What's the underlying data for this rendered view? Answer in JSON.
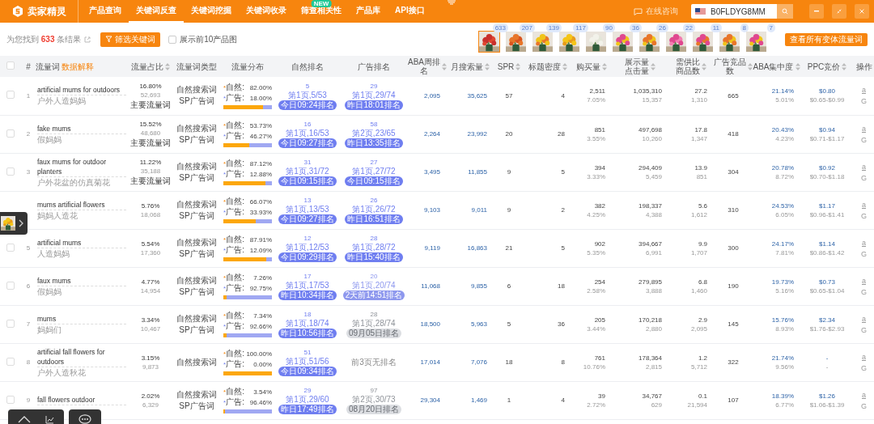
{
  "nav": {
    "brand": "卖家精灵",
    "items": [
      {
        "label": "产品查询",
        "selected": false
      },
      {
        "label": "关键词反查",
        "selected": true
      },
      {
        "label": "关键词挖掘",
        "selected": false
      },
      {
        "label": "关键词收录",
        "selected": false
      },
      {
        "label": "筛查相关性",
        "selected": false,
        "badge": "NEW"
      },
      {
        "label": "产品库",
        "selected": false
      },
      {
        "label": "API接口",
        "selected": false
      }
    ],
    "consult": "在线咨询",
    "search": {
      "value": "B0FLDYG8MM"
    }
  },
  "toolbar": {
    "summary": "为您找到 **633** 条结果",
    "filter_button": "筛选关键词",
    "show_images": {
      "label": "展示前10产品图",
      "checked": false
    },
    "variants_button": "查看所有变体流量词",
    "thumbnails": [
      {
        "count": "633",
        "selected": true
      },
      {
        "count": "207",
        "selected": false
      },
      {
        "count": "139",
        "selected": false
      },
      {
        "count": "117",
        "selected": false
      },
      {
        "count": "90",
        "selected": false
      },
      {
        "count": "36",
        "selected": false
      },
      {
        "count": "26",
        "selected": false
      },
      {
        "count": "22",
        "selected": false
      },
      {
        "count": "11",
        "selected": false
      },
      {
        "count": "8",
        "selected": false
      },
      {
        "count": "7",
        "selected": false
      }
    ]
  },
  "table": {
    "select_all_checked": false,
    "columns": [
      {
        "lines": [
          "#"
        ],
        "sortable": false
      },
      {
        "lines": [
          "流量词"
        ],
        "sortable": false,
        "link": "数据解释"
      },
      {
        "lines": [
          "流量占比"
        ],
        "sortable": true
      },
      {
        "lines": [
          "流量词类型"
        ],
        "sortable": false
      },
      {
        "lines": [
          "流量分布"
        ],
        "sortable": false
      },
      {
        "lines": [
          "自然排名"
        ],
        "sortable": false
      },
      {
        "lines": [
          "广告排名"
        ],
        "sortable": false
      },
      {
        "lines": [
          "ABA周排名"
        ],
        "sortable": true
      },
      {
        "lines": [
          "月搜索量"
        ],
        "sortable": true
      },
      {
        "lines": [
          "SPR"
        ],
        "sortable": true
      },
      {
        "lines": [
          "标题密度"
        ],
        "sortable": true
      },
      {
        "lines": [
          "购买量"
        ],
        "sortable": true
      },
      {
        "lines": [
          "展示量",
          "点击量"
        ],
        "sortable": true
      },
      {
        "lines": [
          "需供比",
          "商品数"
        ],
        "sortable": true
      },
      {
        "lines": [
          "广告竞品数"
        ],
        "sortable": true
      },
      {
        "lines": [
          "ABA集中度"
        ],
        "sortable": true
      },
      {
        "lines": [
          "PPC竞价"
        ],
        "sortable": true
      },
      {
        "lines": [
          "操作"
        ],
        "sortable": false
      }
    ],
    "rows": [
      {
        "index": "1",
        "checked": false,
        "keyword": "artificial mums for outdoors",
        "translation": "户外人造妈妈",
        "share": "16.80%",
        "share_count": "52,693",
        "tag": "主要流量词",
        "types": [
          "自然搜索词",
          "SP广告词"
        ],
        "split": [
          {
            "bullet": "*",
            "label": "自然:",
            "pct": "82.00%"
          },
          {
            "bullet": "*",
            "label": "广告:",
            "pct": "18.00%"
          }
        ],
        "level": 0.82,
        "organic": {
          "rank": "5",
          "page": "第1页,5/53",
          "time": "今日09:24排名",
          "faded": false,
          "greyed": false
        },
        "ad": {
          "rank": "29",
          "page": "第1页,29/74",
          "time": "昨日18:01排名",
          "faded": false,
          "greyed": false
        },
        "aba": "2,095",
        "monthly": "35,625",
        "spr": "57",
        "title_density": "4",
        "buys": "2,511",
        "buys_pct": "7.05%",
        "impressions": "1,035,310",
        "clicks": "15,357",
        "ratio": "27.2",
        "products": "1,310",
        "ad_count": "665",
        "aba_conc": "21.14%",
        "aba_conc2": "5.01%",
        "ppc": "$0.80",
        "ppc_range": "$0.65-$0.99",
        "links": [
          "a",
          "G"
        ]
      },
      {
        "index": "2",
        "checked": false,
        "keyword": "fake mums",
        "translation": "假妈妈",
        "share": "15.52%",
        "share_count": "48,680",
        "tag": "主要流量词",
        "types": [
          "自然搜索词",
          "SP广告词"
        ],
        "split": [
          {
            "bullet": "*",
            "label": "自然:",
            "pct": "53.73%"
          },
          {
            "bullet": "*",
            "label": "广告:",
            "pct": "46.27%"
          }
        ],
        "level": 0.5373,
        "organic": {
          "rank": "16",
          "page": "第1页,16/53",
          "time": "今日09:27排名",
          "faded": false,
          "greyed": false
        },
        "ad": {
          "rank": "58",
          "page": "第2页,23/65",
          "time": "昨日13:35排名",
          "faded": false,
          "greyed": false
        },
        "aba": "2,264",
        "monthly": "23,992",
        "spr": "20",
        "title_density": "28",
        "buys": "851",
        "buys_pct": "3.55%",
        "impressions": "497,698",
        "clicks": "10,260",
        "ratio": "17.8",
        "products": "1,347",
        "ad_count": "418",
        "aba_conc": "20.43%",
        "aba_conc2": "4.23%",
        "ppc": "$0.94",
        "ppc_range": "$0.71-$1.17",
        "links": [
          "a",
          "G"
        ]
      },
      {
        "index": "3",
        "checked": false,
        "keyword": "faux mums for outdoor planters",
        "translation": "户外花盆的仿真菊花",
        "share": "11.22%",
        "share_count": "35,188",
        "tag": "主要流量词",
        "types": [
          "自然搜索词",
          "SP广告词"
        ],
        "split": [
          {
            "bullet": "*",
            "label": "自然:",
            "pct": "87.12%"
          },
          {
            "bullet": "*",
            "label": "广告:",
            "pct": "12.88%"
          }
        ],
        "level": 0.8712,
        "organic": {
          "rank": "31",
          "page": "第1页,31/72",
          "time": "今日09:15排名",
          "faded": false,
          "greyed": false
        },
        "ad": {
          "rank": "27",
          "page": "第1页,27/72",
          "time": "今日09:15排名",
          "faded": false,
          "greyed": false
        },
        "aba": "3,495",
        "monthly": "11,855",
        "spr": "9",
        "title_density": "5",
        "buys": "394",
        "buys_pct": "3.33%",
        "impressions": "294,409",
        "clicks": "5,459",
        "ratio": "13.9",
        "products": "851",
        "ad_count": "304",
        "aba_conc": "20.78%",
        "aba_conc2": "8.72%",
        "ppc": "$0.92",
        "ppc_range": "$0.70-$1.18",
        "links": [
          "a",
          "G"
        ]
      },
      {
        "keyword": "mums artificial flowers",
        "translation": "妈妈人造花",
        "share": "5.76%",
        "share_count": "18,068",
        "types": [
          "自然搜索词",
          "SP广告词"
        ],
        "split": [
          {
            "bullet": "*",
            "label": "自然:",
            "pct": "66.07%"
          },
          {
            "bullet": "*",
            "label": "广告:",
            "pct": "33.93%"
          }
        ],
        "level": 0.6607,
        "organic": {
          "rank": "13",
          "page": "第1页,13/53",
          "time": "今日09:27排名",
          "faded": false,
          "greyed": false
        },
        "ad": {
          "rank": "26",
          "page": "第1页,26/72",
          "time": "昨日16:51排名",
          "faded": false,
          "greyed": false
        },
        "aba": "9,103",
        "monthly": "9,011",
        "spr": "9",
        "title_density": "2",
        "buys": "382",
        "buys_pct": "4.25%",
        "impressions": "198,337",
        "clicks": "4,388",
        "ratio": "5.6",
        "products": "1,612",
        "ad_count": "310",
        "aba_conc": "24.53%",
        "aba_conc2": "6.05%",
        "ppc": "$1.17",
        "ppc_range": "$0.96-$1.41",
        "links": [
          "a",
          "G"
        ]
      },
      {
        "index": "5",
        "checked": false,
        "keyword": "artificial mums",
        "translation": "人造妈妈",
        "share": "5.54%",
        "share_count": "17,360",
        "types": [
          "自然搜索词",
          "SP广告词"
        ],
        "split": [
          {
            "bullet": "*",
            "label": "自然:",
            "pct": "87.91%"
          },
          {
            "bullet": "*",
            "label": "广告:",
            "pct": "12.09%"
          }
        ],
        "level": 0.8791,
        "organic": {
          "rank": "12",
          "page": "第1页,12/53",
          "time": "今日09:29排名",
          "faded": false,
          "greyed": false
        },
        "ad": {
          "rank": "28",
          "page": "第1页,28/72",
          "time": "昨日15:40排名",
          "faded": false,
          "greyed": false
        },
        "aba": "9,119",
        "monthly": "16,863",
        "spr": "21",
        "title_density": "5",
        "buys": "902",
        "buys_pct": "5.35%",
        "impressions": "394,667",
        "clicks": "6,991",
        "ratio": "9.9",
        "products": "1,707",
        "ad_count": "300",
        "aba_conc": "24.17%",
        "aba_conc2": "7.81%",
        "ppc": "$1.14",
        "ppc_range": "$0.86-$1.42",
        "links": [
          "a",
          "G"
        ]
      },
      {
        "index": "6",
        "checked": false,
        "keyword": "faux mums",
        "translation": "假妈妈",
        "share": "4.77%",
        "share_count": "14,954",
        "types": [
          "自然搜索词",
          "SP广告词"
        ],
        "split": [
          {
            "bullet": "*",
            "label": "自然:",
            "pct": "7.26%"
          },
          {
            "bullet": "*",
            "label": "广告:",
            "pct": "92.75%"
          }
        ],
        "level": 0.0726,
        "organic": {
          "rank": "17",
          "page": "第1页,17/53",
          "time": "昨日10:34排名",
          "faded": false,
          "greyed": false
        },
        "ad": {
          "rank": "20",
          "page": "第1页,20/74",
          "time": "2天前14:51排名",
          "faded": true,
          "greyed": false
        },
        "aba": "11,068",
        "monthly": "9,855",
        "spr": "6",
        "title_density": "18",
        "buys": "254",
        "buys_pct": "2.58%",
        "impressions": "279,895",
        "clicks": "3,888",
        "ratio": "6.8",
        "products": "1,460",
        "ad_count": "190",
        "aba_conc": "19.73%",
        "aba_conc2": "5.16%",
        "ppc": "$0.73",
        "ppc_range": "$0.65-$1.04",
        "links": [
          "a",
          "G"
        ]
      },
      {
        "index": "7",
        "checked": false,
        "keyword": "mums",
        "translation": "妈妈们",
        "share": "3.34%",
        "share_count": "10,467",
        "types": [
          "自然搜索词",
          "SP广告词"
        ],
        "split": [
          {
            "bullet": "*",
            "label": "自然:",
            "pct": "7.34%"
          },
          {
            "bullet": "*",
            "label": "广告:",
            "pct": "92.66%"
          }
        ],
        "level": 0.0734,
        "organic": {
          "rank": "18",
          "page": "第1页,18/74",
          "time": "昨日10:56排名",
          "faded": false,
          "greyed": false
        },
        "ad": {
          "rank": "28",
          "page": "第1页,28/74",
          "time": "09月05日排名",
          "faded": false,
          "greyed": true
        },
        "aba": "18,500",
        "monthly": "5,963",
        "spr": "5",
        "title_density": "36",
        "buys": "205",
        "buys_pct": "3.44%",
        "impressions": "170,218",
        "clicks": "2,880",
        "ratio": "2.9",
        "products": "2,095",
        "ad_count": "145",
        "aba_conc": "15.76%",
        "aba_conc2": "8.93%",
        "ppc": "$2.34",
        "ppc_range": "$1.76-$2.93",
        "links": [
          "a",
          "G"
        ]
      },
      {
        "index": "8",
        "checked": false,
        "keyword": "artificial fall flowers for outdoors",
        "translation": "户外人造秋花",
        "share": "3.15%",
        "share_count": "9,873",
        "types": [
          "自然搜索词"
        ],
        "split": [
          {
            "bullet": "*",
            "label": "自然:",
            "pct": "100.00%"
          },
          {
            "bullet": "*",
            "label": "广告:",
            "pct": "0.00%"
          }
        ],
        "level": 1,
        "organic": {
          "rank": "51",
          "page": "第1页,51/56",
          "time": "今日09:34排名",
          "faded": false,
          "greyed": false
        },
        "ad": {
          "none": "前3页无排名"
        },
        "aba": "17,014",
        "monthly": "7,076",
        "spr": "18",
        "title_density": "8",
        "buys": "761",
        "buys_pct": "10.76%",
        "impressions": "178,364",
        "clicks": "2,815",
        "ratio": "1.2",
        "products": "5,712",
        "ad_count": "322",
        "aba_conc": "21.74%",
        "aba_conc2": "9.56%",
        "ppc": "-",
        "ppc_range": "-",
        "links": [
          "a",
          "G"
        ]
      },
      {
        "index": "9",
        "checked": false,
        "keyword": "fall flowers outdoor",
        "share": "2.02%",
        "share_count": "6,329",
        "types": [
          "自然搜索词",
          "SP广告词"
        ],
        "split": [
          {
            "bullet": "*",
            "label": "自然:",
            "pct": "3.54%"
          },
          {
            "bullet": "*",
            "label": "广告:",
            "pct": "96.46%"
          }
        ],
        "level": 0.0354,
        "organic": {
          "rank": "29",
          "page": "第1页,29/60",
          "time": "昨日17:49排名",
          "faded": false,
          "greyed": false
        },
        "ad": {
          "rank": "97",
          "page": "第2页,30/73",
          "time": "08月20日排名",
          "faded": false,
          "greyed": true
        },
        "aba": "29,304",
        "monthly": "1,469",
        "spr": "1",
        "title_density": "4",
        "buys": "39",
        "buys_pct": "2.72%",
        "impressions": "34,767",
        "clicks": "629",
        "ratio": "0.1",
        "products": "21,594",
        "ad_count": "107",
        "aba_conc": "18.39%",
        "aba_conc2": "6.77%",
        "ppc": "$1.26",
        "ppc_range": "$1.06-$1.39",
        "links": [
          "a",
          "G"
        ]
      }
    ]
  }
}
